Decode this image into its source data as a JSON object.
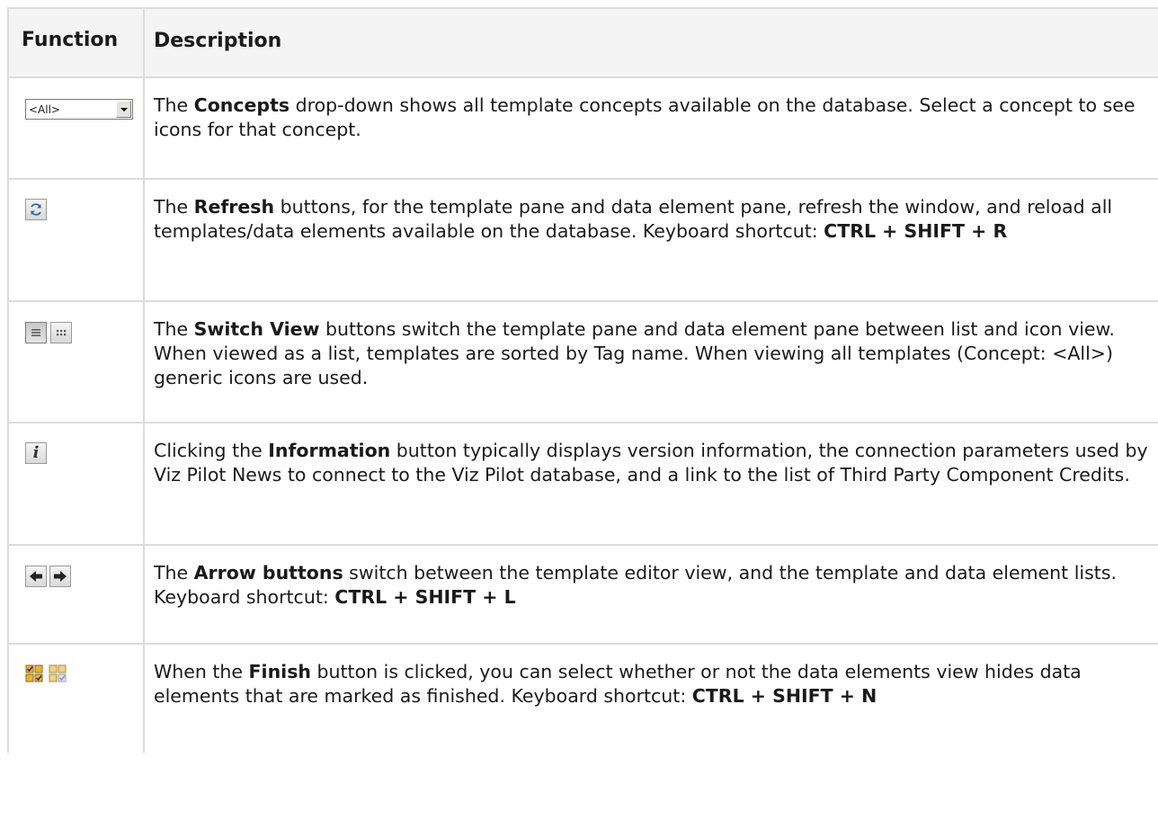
{
  "header": {
    "function": "Function",
    "description": "Description"
  },
  "rows": [
    {
      "id": "concepts",
      "dropdown_value": "<All>",
      "parts": [
        "The ",
        "Concepts",
        " drop-down shows all template concepts available on the database. Select a concept to see icons for that concept."
      ]
    },
    {
      "id": "refresh",
      "parts": [
        "The ",
        "Refresh",
        " buttons, for the template pane and data element pane, refresh the window, and reload all templates/data elements available on the database. Keyboard shortcut: ",
        "CTRL + SHIFT + R"
      ]
    },
    {
      "id": "switch-view",
      "parts": [
        "The ",
        "Switch View",
        " buttons switch the template pane and data element pane between list and icon view. When viewed as a list, templates are sorted by Tag name. When viewing all templates (Concept: <All>) generic icons are used."
      ]
    },
    {
      "id": "information",
      "parts": [
        "Clicking the ",
        "Information",
        " button typically displays version information, the connection parameters used by Viz Pilot News to connect to the Viz Pilot database, and a link to the list of Third Party Component Credits."
      ]
    },
    {
      "id": "arrows",
      "parts": [
        "The ",
        "Arrow buttons",
        " switch between the template editor view, and the template and data element lists. Keyboard shortcut: ",
        "CTRL + SHIFT + L"
      ]
    },
    {
      "id": "finish",
      "parts": [
        "When the ",
        "Finish",
        " button is clicked, you can select whether or not the data elements view hides data elements that are marked as finished. Keyboard shortcut: ",
        "CTRL + SHIFT + N"
      ]
    }
  ],
  "icons": {
    "refresh": "refresh-icon",
    "switch_view": [
      "list-view-icon",
      "icon-view-icon"
    ],
    "information": "information-icon",
    "arrows": [
      "arrow-left-icon",
      "arrow-right-icon"
    ],
    "finish": [
      "finish-show-icon",
      "finish-hide-icon"
    ]
  }
}
